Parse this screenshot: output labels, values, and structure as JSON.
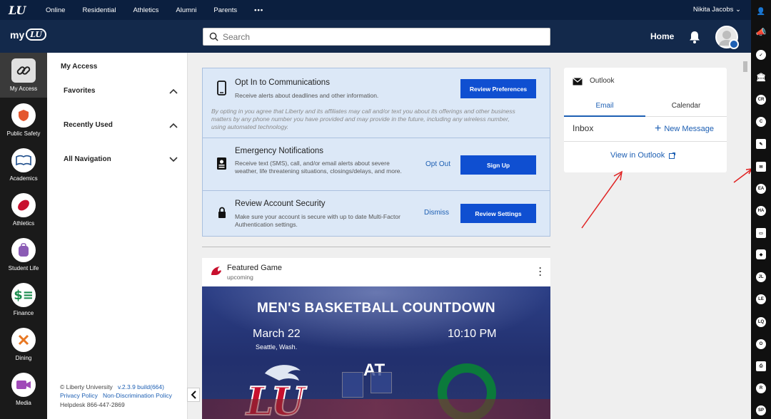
{
  "topbar": {
    "logo": "LU",
    "nav": [
      "Online",
      "Residential",
      "Athletics",
      "Alumni",
      "Parents"
    ],
    "more": "•••",
    "user": "Nikita Jacobs ⌄"
  },
  "header": {
    "brand": "my",
    "brand_badge": "LU",
    "search_placeholder": "Search",
    "home": "Home"
  },
  "leftnav": [
    {
      "label": "My Access",
      "icon": "link-icon"
    },
    {
      "label": "Public Safety",
      "icon": "shield-icon"
    },
    {
      "label": "Academics",
      "icon": "book-icon"
    },
    {
      "label": "Athletics",
      "icon": "football-icon"
    },
    {
      "label": "Student Life",
      "icon": "backpack-icon"
    },
    {
      "label": "Finance",
      "icon": "dollar-icon"
    },
    {
      "label": "Dining",
      "icon": "utensils-icon"
    },
    {
      "label": "Media",
      "icon": "video-icon"
    }
  ],
  "subnav": {
    "title": "My Access",
    "rows": [
      "Favorites",
      "Recently Used",
      "All Navigation"
    ],
    "footer": {
      "copyright": "© Liberty University",
      "version": "v.2.3.9 build(664)",
      "privacy": "Privacy Policy",
      "nondiscrimination": "Non-Discrimination Policy",
      "helpdesk": "Helpdesk 866-447-2869"
    }
  },
  "communications": {
    "optin": {
      "title": "Opt In to Communications",
      "desc": "Receive alerts about deadlines and other information.",
      "button": "Review Preferences",
      "legal": "By opting in you agree that Liberty and its affiliates may call and/or text you about its offerings and other business matters by any phone number you have provided and may provide in the future, including any wireless number, using automated technology."
    },
    "emergency": {
      "title": "Emergency Notifications",
      "desc": "Receive text (SMS), call, and/or email alerts about severe weather, life threatening situations, closings/delays, and more.",
      "link": "Opt Out",
      "button": "Sign Up"
    },
    "security": {
      "title": "Review Account Security",
      "desc": "Make sure your account is secure with up to date Multi-Factor Authentication settings.",
      "link": "Dismiss",
      "button": "Review Settings"
    }
  },
  "featured": {
    "title": "Featured Game",
    "subtitle": "upcoming",
    "banner": "MEN'S BASKETBALL COUNTDOWN",
    "date": "March 22",
    "location": "Seattle, Wash.",
    "time": "10:10 PM",
    "vs": "AT",
    "home_team": "LU",
    "away_team": "O"
  },
  "outlook": {
    "title": "Outlook",
    "tabs": [
      "Email",
      "Calendar"
    ],
    "inbox": "Inbox",
    "new_message": "New Message",
    "view_link": "View in Outlook"
  },
  "rightrail": [
    "megaphone",
    "check",
    "bank",
    "CR",
    "C",
    "doc",
    "mail",
    "EA",
    "HA",
    "laptop",
    "tag",
    "JL",
    "LE",
    "LQ",
    "O",
    "print",
    "R",
    "SP"
  ],
  "colors": {
    "primary": "#13294b",
    "top": "#0b1f3f",
    "accent": "#0f4fd1",
    "link": "#1d5fb3",
    "panel": "#dce8f7"
  }
}
